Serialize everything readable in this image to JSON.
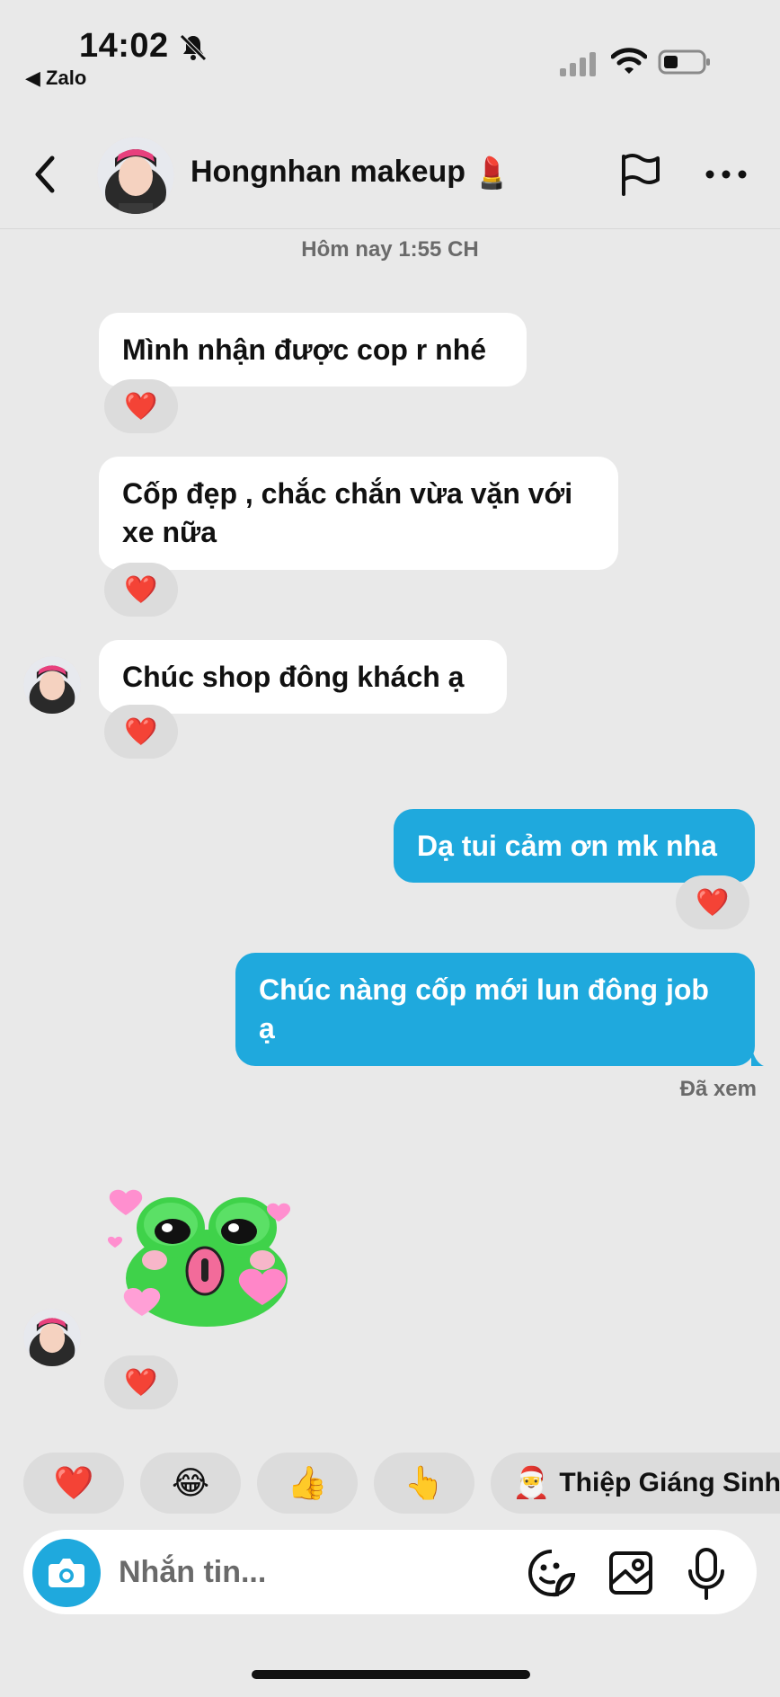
{
  "status_bar": {
    "time": "14:02",
    "back_app": "◀ Zalo"
  },
  "header": {
    "title": "Hongnhan makeup",
    "title_emoji": "💄"
  },
  "chat": {
    "day_label": "Hôm nay 1:55 CH",
    "messages": [
      {
        "from": "contact",
        "text": "Mình nhận được cop r nhé",
        "reaction": "❤️"
      },
      {
        "from": "contact",
        "text": "Cốp đẹp , chắc chắn vừa vặn với xe nữa",
        "reaction": "❤️"
      },
      {
        "from": "contact",
        "text": "Chúc shop đông khách ạ",
        "reaction": "❤️"
      },
      {
        "from": "me",
        "text": "Dạ tui cảm ơn mk nha",
        "reaction": "❤️"
      },
      {
        "from": "me",
        "text": "Chúc nàng cốp mới lun đông job ạ",
        "reaction": ""
      },
      {
        "from": "contact",
        "text": "",
        "sticker": "frog-sticker",
        "reaction": "❤️"
      }
    ],
    "seen_label": "Đã xem"
  },
  "quick_reactions": [
    {
      "glyph": "❤️",
      "icon": "heart-icon"
    },
    {
      "glyph": "😂",
      "icon": "laughing-face-icon"
    },
    {
      "glyph": "👍",
      "icon": "thumbs-up-icon"
    },
    {
      "glyph": "👆",
      "icon": "pointing-hand-icon"
    }
  ],
  "christmas_card": {
    "glyph": "🎅",
    "label": "Thiệp Giáng Sinh"
  },
  "composer": {
    "placeholder": "Nhắn tin..."
  },
  "colors": {
    "outgoing_bubble": "#1fa9dd",
    "incoming_bubble": "#ffffff",
    "background": "#e9e9e9",
    "reaction_pill": "#dcdcdc"
  }
}
